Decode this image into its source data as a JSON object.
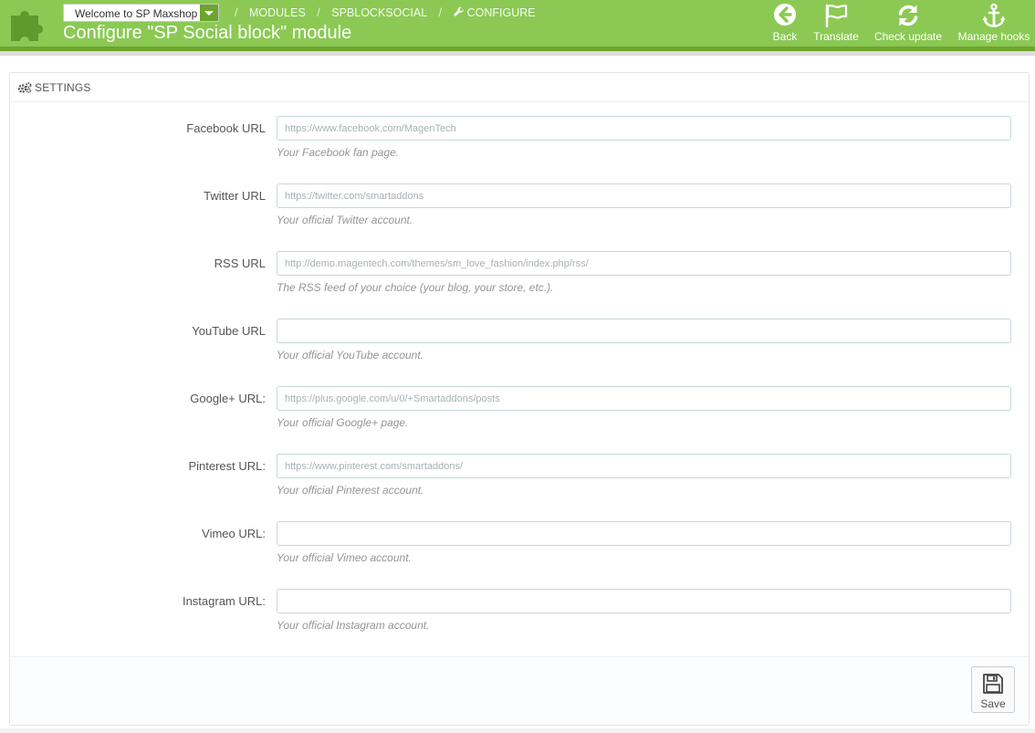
{
  "header": {
    "shop_select": "Welcome to SP Maxshop",
    "breadcrumbs": [
      "MODULES",
      "SPBLOCKSOCIAL",
      "CONFIGURE"
    ],
    "title": "Configure \"SP Social block\" module",
    "toolbar": [
      {
        "label": "Back",
        "icon": "back-arrow-icon"
      },
      {
        "label": "Translate",
        "icon": "flag-icon"
      },
      {
        "label": "Check update",
        "icon": "refresh-icon"
      },
      {
        "label": "Manage hooks",
        "icon": "anchor-icon"
      }
    ],
    "colors": {
      "header": "#8bc954",
      "header_dark": "#6ba52c"
    }
  },
  "panel": {
    "heading": "SETTINGS",
    "heading_icon": "gears-icon",
    "fields": [
      {
        "label": "Facebook URL",
        "value": "https://www.facebook.com/MagenTech",
        "help": "Your Facebook fan page."
      },
      {
        "label": "Twitter URL",
        "value": "https://twitter.com/smartaddons",
        "help": "Your official Twitter account."
      },
      {
        "label": "RSS URL",
        "value": "http://demo.magentech.com/themes/sm_love_fashion/index.php/rss/",
        "help": "The RSS feed of your choice (your blog, your store, etc.)."
      },
      {
        "label": "YouTube URL",
        "value": "",
        "help": "Your official YouTube account."
      },
      {
        "label": "Google+ URL:",
        "value": "https://plus.google.com/u/0/+Smartaddons/posts",
        "help": "Your official Google+ page."
      },
      {
        "label": "Pinterest URL:",
        "value": "https://www.pinterest.com/smartaddons/",
        "help": "Your official Pinterest account."
      },
      {
        "label": "Vimeo URL:",
        "value": "",
        "help": "Your official Vimeo account."
      },
      {
        "label": "Instagram URL:",
        "value": "",
        "help": "Your official Instagram account."
      }
    ],
    "save_label": "Save",
    "save_icon": "floppy-disk-icon"
  }
}
